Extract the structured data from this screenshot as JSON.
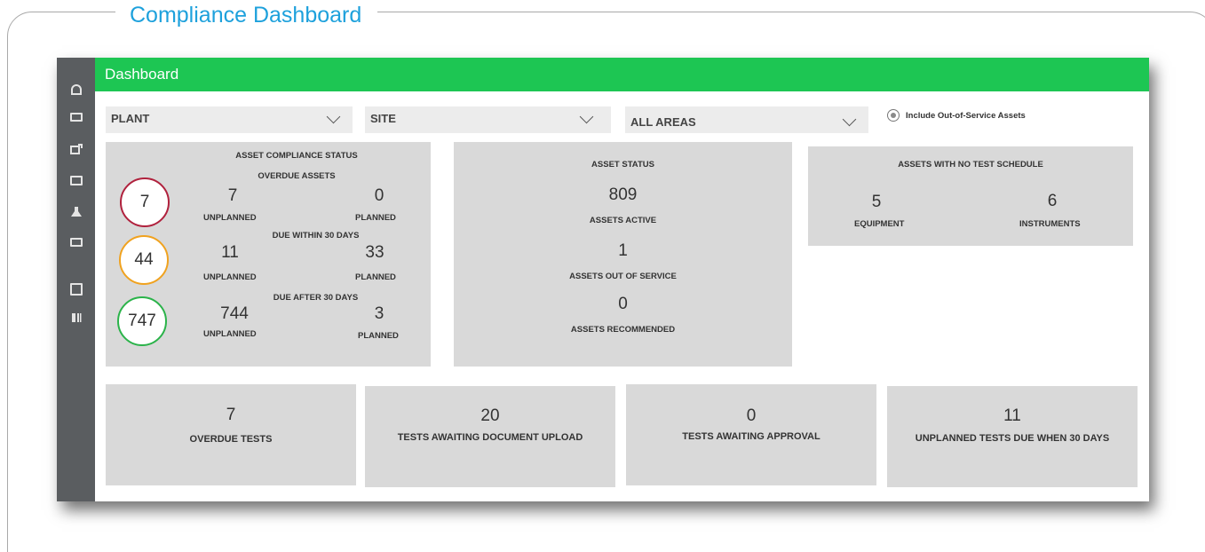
{
  "page_title": "Compliance Dashboard",
  "topbar": {
    "title": "Dashboard"
  },
  "sidebar": {
    "icons": [
      "home-icon",
      "folder-icon",
      "edit-icon",
      "calendar-icon",
      "lab-flask-icon",
      "monitor-icon",
      "document-icon",
      "library-icon"
    ]
  },
  "filters": {
    "plant": "PLANT",
    "site": "SITE",
    "area": "ALL AREAS",
    "include_oos_label": "Include Out-of-Service Assets",
    "include_oos_selected": true
  },
  "compliance": {
    "title": "ASSET COMPLIANCE STATUS",
    "groups": [
      {
        "heading": "OVERDUE ASSETS",
        "total": "7",
        "unplanned": "7",
        "planned": "0",
        "color": "#b0213d"
      },
      {
        "heading": "DUE WITHIN 30 DAYS",
        "total": "44",
        "unplanned": "11",
        "planned": "33",
        "color": "#f0a21f"
      },
      {
        "heading": "DUE AFTER 30 DAYS",
        "total": "747",
        "unplanned": "744",
        "planned": "3",
        "color": "#2bb34a"
      }
    ],
    "unplanned_label": "UNPLANNED",
    "planned_label": "PLANNED"
  },
  "asset_status": {
    "title": "ASSET STATUS",
    "active_value": "809",
    "active_label": "ASSETS ACTIVE",
    "oos_value": "1",
    "oos_label": "ASSETS OUT OF SERVICE",
    "recommended_value": "0",
    "recommended_label": "ASSETS RECOMMENDED"
  },
  "no_schedule": {
    "title": "ASSETS WITH NO TEST SCHEDULE",
    "equipment_value": "5",
    "equipment_label": "EQUIPMENT",
    "instruments_value": "6",
    "instruments_label": "INSTRUMENTS"
  },
  "stats": [
    {
      "value": "7",
      "label": "OVERDUE TESTS"
    },
    {
      "value": "20",
      "label": "TESTS AWAITING DOCUMENT UPLOAD"
    },
    {
      "value": "0",
      "label": "TESTS AWAITING APPROVAL"
    },
    {
      "value": "11",
      "label": "UNPLANNED TESTS DUE WHEN 30 DAYS"
    }
  ]
}
